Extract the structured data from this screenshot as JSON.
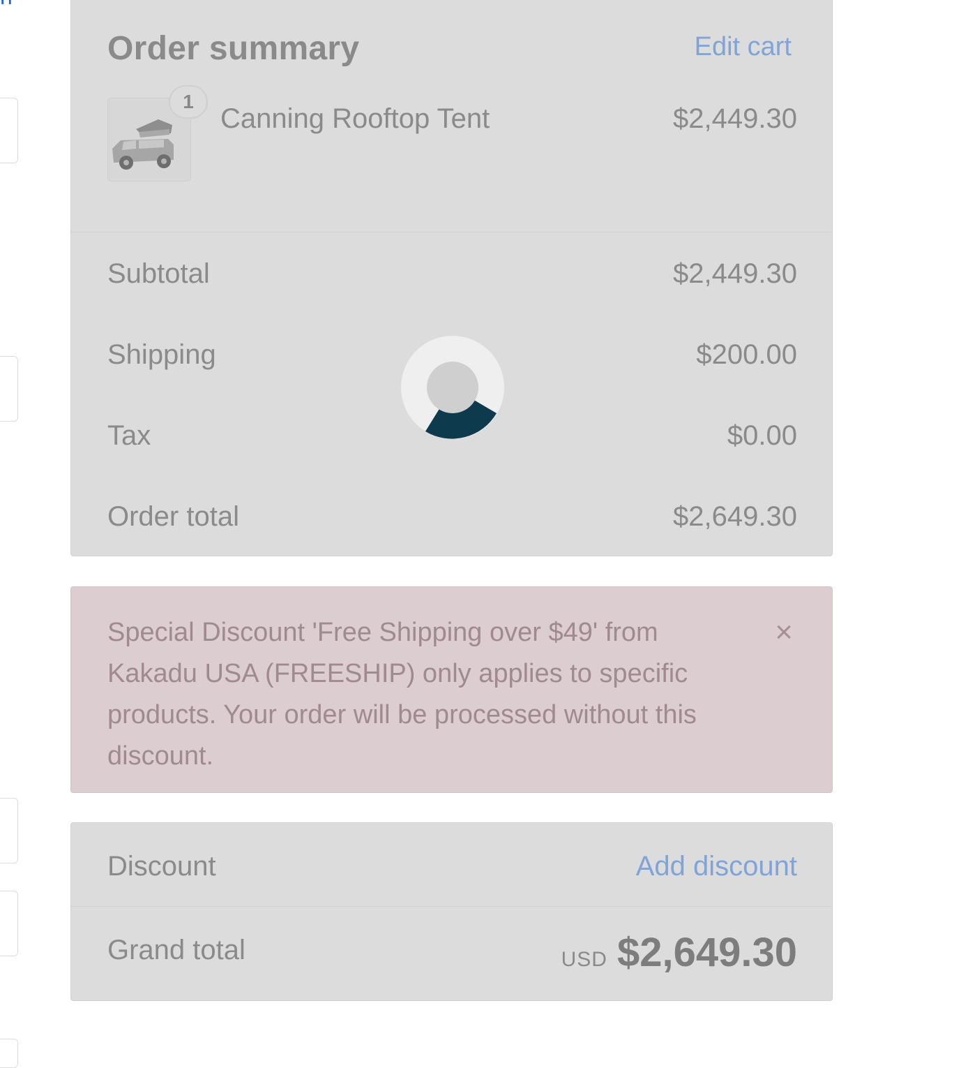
{
  "summary": {
    "title": "Order summary",
    "edit_cart": "Edit cart",
    "item": {
      "name": "Canning Rooftop Tent",
      "price": "$2,449.30",
      "quantity": "1"
    },
    "totals": {
      "subtotal_label": "Subtotal",
      "subtotal": "$2,449.30",
      "shipping_label": "Shipping",
      "shipping": "$200.00",
      "tax_label": "Tax",
      "tax": "$0.00",
      "order_total_label": "Order total",
      "order_total": "$2,649.30"
    }
  },
  "alert": {
    "message": "Special Discount 'Free Shipping over $49' from Kakadu USA (FREESHIP) only applies to specific products. Your order will be processed without this discount.",
    "close": "×"
  },
  "discount": {
    "label": "Discount",
    "link": "Add discount"
  },
  "grand_total": {
    "label": "Grand total",
    "currency": "USD",
    "amount": "$2,649.30"
  },
  "icons": {
    "spinner": "loading-spinner-icon",
    "product_thumb": "car-rooftop-tent-image",
    "close": "close-icon"
  },
  "colors": {
    "link": "#7fa4d8",
    "spinner_accent": "#0d3a4c",
    "alert_bg": "#dccdd1",
    "panel_bg": "#dcdcdc"
  }
}
